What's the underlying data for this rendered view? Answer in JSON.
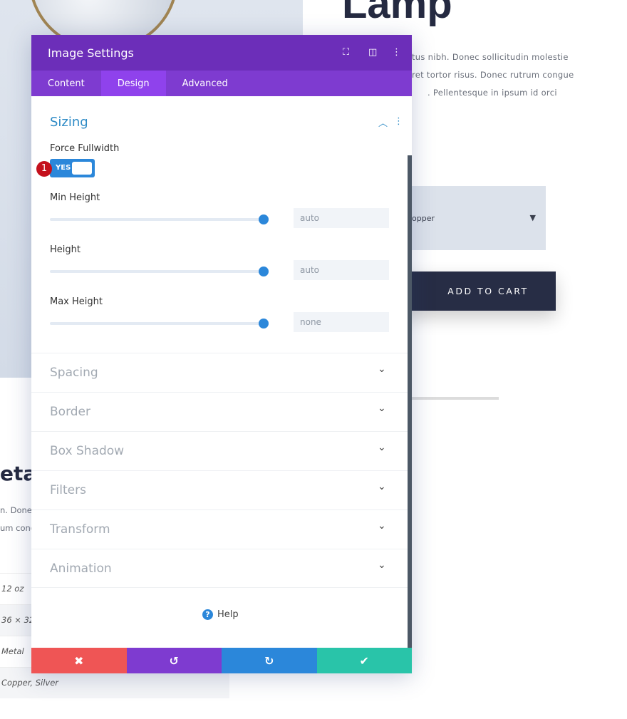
{
  "page": {
    "title": "Lamp",
    "description_lines": [
      "tus nibh. Donec sollicitudin molestie",
      "ret tortor risus. Donec rutrum congue",
      ". Pellentesque in ipsum id orci"
    ],
    "select_value": "opper",
    "add_to_cart": "ADD TO CART",
    "meta_heading": "eta",
    "meta_text": [
      "n. Done",
      "um cong"
    ],
    "table_values": [
      "12 oz",
      "36 × 32",
      "Metal",
      "Copper, Silver"
    ]
  },
  "modal": {
    "title": "Image Settings",
    "tabs": [
      {
        "label": "Content"
      },
      {
        "label": "Design",
        "active": true
      },
      {
        "label": "Advanced"
      }
    ],
    "section": "Sizing",
    "force_fullwidth_label": "Force Fullwidth",
    "toggle_value": "YES",
    "badge": "1",
    "fields": [
      {
        "label": "Min Height",
        "value": "auto",
        "slider": 1.0
      },
      {
        "label": "Height",
        "value": "auto",
        "slider": 1.0
      },
      {
        "label": "Max Height",
        "value": "none",
        "slider": 1.0
      }
    ],
    "groups": [
      "Spacing",
      "Border",
      "Box Shadow",
      "Filters",
      "Transform",
      "Animation"
    ],
    "help": "Help",
    "colors": {
      "header": "#6c2eb9",
      "tabs": "#7e3bd0",
      "cancel": "#ef5555",
      "undo": "#7e3bd0",
      "redo": "#2b87da",
      "save": "#29c4a9"
    }
  }
}
